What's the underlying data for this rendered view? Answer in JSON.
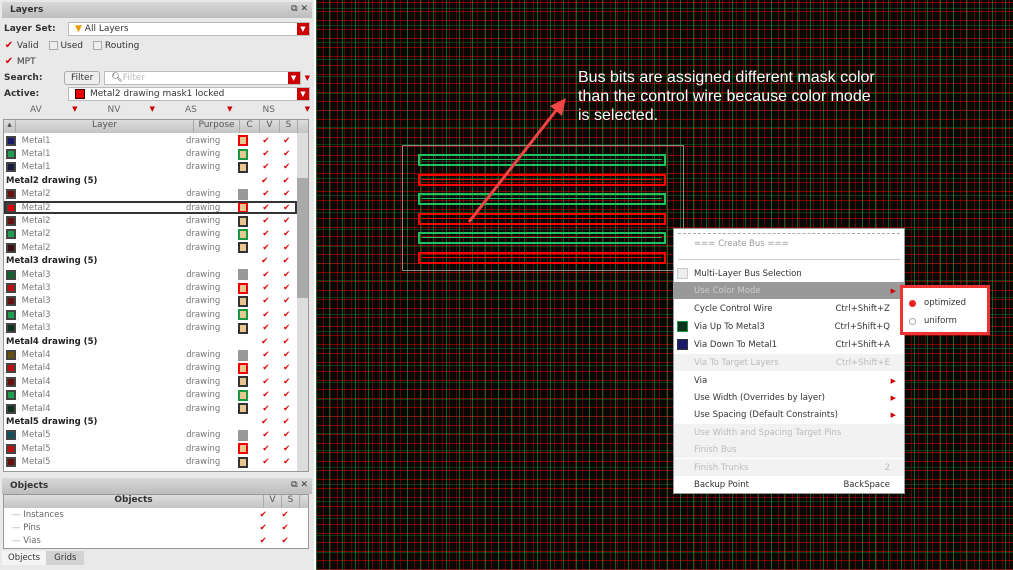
{
  "layers_panel": {
    "title": "Layers",
    "layer_set_label": "Layer Set:",
    "layer_set_value": "All Layers",
    "filters": [
      {
        "label": "Valid",
        "checked": true
      },
      {
        "label": "Used",
        "checked": false
      },
      {
        "label": "Routing",
        "checked": false
      },
      {
        "label": "MPT",
        "checked": true
      }
    ],
    "search_label": "Search:",
    "filter_button": "Filter",
    "filter_placeholder": "Filter",
    "active_label": "Active:",
    "active_value": "Metal2 drawing mask1 locked",
    "visibility_columns": [
      "AV",
      "NV",
      "AS",
      "NS"
    ],
    "table_headers": [
      "Layer",
      "Purpose",
      "C",
      "V",
      "S"
    ],
    "rows": [
      {
        "type": "layer",
        "name": "Metal1",
        "purpose": "drawing",
        "color": "#1a1a6a",
        "mask": "red"
      },
      {
        "type": "layer",
        "name": "Metal1",
        "purpose": "drawing",
        "color": "#1fa050",
        "mask": "green"
      },
      {
        "type": "layer",
        "name": "Metal1",
        "purpose": "drawing",
        "color": "#1a1a40",
        "mask": "black"
      },
      {
        "type": "group",
        "name": "Metal2 drawing (5)"
      },
      {
        "type": "layer",
        "name": "Metal2",
        "purpose": "drawing",
        "color": "#6a1010",
        "mask": "gray"
      },
      {
        "type": "layer",
        "name": "Metal2",
        "purpose": "drawing",
        "color": "#e00000",
        "mask": "red",
        "selected": true
      },
      {
        "type": "layer",
        "name": "Metal2",
        "purpose": "drawing",
        "color": "#6a1010",
        "mask": "black"
      },
      {
        "type": "layer",
        "name": "Metal2",
        "purpose": "drawing",
        "color": "#1fa050",
        "mask": "green"
      },
      {
        "type": "layer",
        "name": "Metal2",
        "purpose": "drawing",
        "color": "#3a1010",
        "mask": "black"
      },
      {
        "type": "group",
        "name": "Metal3 drawing (5)"
      },
      {
        "type": "layer",
        "name": "Metal3",
        "purpose": "drawing",
        "color": "#106030",
        "mask": "gray"
      },
      {
        "type": "layer",
        "name": "Metal3",
        "purpose": "drawing",
        "color": "#c01010",
        "mask": "red"
      },
      {
        "type": "layer",
        "name": "Metal3",
        "purpose": "drawing",
        "color": "#6a1010",
        "mask": "black"
      },
      {
        "type": "layer",
        "name": "Metal3",
        "purpose": "drawing",
        "color": "#1fa050",
        "mask": "green"
      },
      {
        "type": "layer",
        "name": "Metal3",
        "purpose": "drawing",
        "color": "#103020",
        "mask": "black"
      },
      {
        "type": "group",
        "name": "Metal4 drawing (5)"
      },
      {
        "type": "layer",
        "name": "Metal4",
        "purpose": "drawing",
        "color": "#6a5010",
        "mask": "gray"
      },
      {
        "type": "layer",
        "name": "Metal4",
        "purpose": "drawing",
        "color": "#c01010",
        "mask": "red"
      },
      {
        "type": "layer",
        "name": "Metal4",
        "purpose": "drawing",
        "color": "#6a1010",
        "mask": "black"
      },
      {
        "type": "layer",
        "name": "Metal4",
        "purpose": "drawing",
        "color": "#1fa050",
        "mask": "green"
      },
      {
        "type": "layer",
        "name": "Metal4",
        "purpose": "drawing",
        "color": "#103020",
        "mask": "black"
      },
      {
        "type": "group",
        "name": "Metal5 drawing (5)"
      },
      {
        "type": "layer",
        "name": "Metal5",
        "purpose": "drawing",
        "color": "#105060",
        "mask": "gray"
      },
      {
        "type": "layer",
        "name": "Metal5",
        "purpose": "drawing",
        "color": "#c01010",
        "mask": "red"
      },
      {
        "type": "layer",
        "name": "Metal5",
        "purpose": "drawing",
        "color": "#6a1010",
        "mask": "black"
      }
    ]
  },
  "objects_panel": {
    "title": "Objects",
    "header": "Objects",
    "cols": [
      "V",
      "S"
    ],
    "items": [
      "Instances",
      "Pins",
      "Vias"
    ]
  },
  "bottom_tabs": [
    "Objects",
    "Grids"
  ],
  "annotation": "Bus bits are assigned different mask color than the control wire because color mode is selected.",
  "context_menu": {
    "header": "=== Create Bus ===",
    "items": [
      {
        "label": "Multi-Layer Bus Selection",
        "shortcut": "",
        "state": "normal",
        "icon": "checkbox"
      },
      {
        "label": "Use Color Mode",
        "shortcut": "",
        "state": "highlighted",
        "submenu": true
      },
      {
        "label": "Cycle Control Wire",
        "shortcut": "Ctrl+Shift+Z",
        "state": "normal"
      },
      {
        "label": "Via Up To Metal3",
        "shortcut": "Ctrl+Shift+Q",
        "state": "normal",
        "icon": "metal3"
      },
      {
        "label": "Via Down To Metal1",
        "shortcut": "Ctrl+Shift+A",
        "state": "normal",
        "icon": "metal1"
      },
      {
        "label": "Via To Target Layers",
        "shortcut": "Ctrl+Shift+E",
        "state": "disabled"
      },
      {
        "label": "Via",
        "shortcut": "",
        "state": "normal",
        "submenu": true
      },
      {
        "label": "Use Width (Overrides by layer)",
        "shortcut": "",
        "state": "normal",
        "submenu": true
      },
      {
        "label": "Use Spacing (Default Constraints)",
        "shortcut": "",
        "state": "normal",
        "submenu": true
      },
      {
        "label": "Use Width and Spacing Target Pins",
        "shortcut": "",
        "state": "disabled"
      },
      {
        "label": "Finish Bus",
        "shortcut": "",
        "state": "disabled"
      },
      {
        "label": "Finish Trunks",
        "shortcut": "2",
        "state": "disabled"
      },
      {
        "label": "Backup Point",
        "shortcut": "BackSpace",
        "state": "normal"
      }
    ]
  },
  "color_mode_submenu": {
    "options": [
      "optimized",
      "uniform"
    ],
    "selected": "optimized"
  },
  "colors": {
    "mask_red": "#ff0000",
    "mask_green": "#1fc060",
    "highlight": "#e33333"
  }
}
